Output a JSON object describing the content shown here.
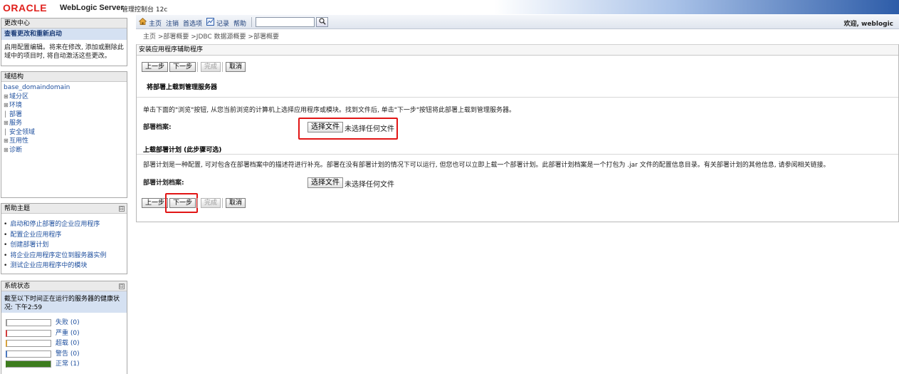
{
  "banner": {
    "logo": "ORACLE",
    "product": "WebLogic Server",
    "subtitle": "管理控制台 12c"
  },
  "change_center": {
    "title": "更改中心",
    "link": "查看更改和重新启动",
    "description": "启用配置编辑。将来在修改, 添加或删除此域中的项目时, 将自动激活这些更改。"
  },
  "domain_structure": {
    "title": "域结构",
    "root": "base_domaindomain",
    "items": [
      {
        "prefix": "⊞",
        "label": "域分区"
      },
      {
        "prefix": "⊞",
        "label": "环境"
      },
      {
        "prefix": "│",
        "label": "部署"
      },
      {
        "prefix": "⊞",
        "label": "服务"
      },
      {
        "prefix": "│",
        "label": "安全领域"
      },
      {
        "prefix": "⊞",
        "label": "互用性"
      },
      {
        "prefix": "⊞",
        "label": "诊断"
      }
    ]
  },
  "help": {
    "title": "帮助主题",
    "toggle": "⊟",
    "items": [
      "启动和停止部署的企业应用程序",
      "配置企业应用程序",
      "创建部署计划",
      "将企业应用程序定位到服务器实例",
      "测试企业应用程序中的模块"
    ]
  },
  "system_status": {
    "title": "系统状态",
    "toggle": "⊟",
    "intro": "截至以下时间正在运行的服务器的健康状况: 下午2:59",
    "rows": [
      {
        "label": "失败 (0)",
        "color": "#9a9a9a",
        "fill": 0
      },
      {
        "label": "严重 (0)",
        "color": "#d43a3a",
        "fill": 0
      },
      {
        "label": "超载 (0)",
        "color": "#d8a23a",
        "fill": 0
      },
      {
        "label": "警告 (0)",
        "color": "#4a78c0",
        "fill": 0
      },
      {
        "label": "正常 (1)",
        "color": "#3d7d1e",
        "fill": 1
      }
    ]
  },
  "toolbar": {
    "home": "主页",
    "logout": "注销",
    "preferences": "首选项",
    "record": "记录",
    "help": "帮助",
    "search_value": "",
    "welcome": "欢迎, weblogic"
  },
  "breadcrumb": "主页 >部署概要 >JDBC 数据源概要 >部署概要",
  "assistant": {
    "title": "安装应用程序辅助程序",
    "back": "上一步",
    "next": "下一步",
    "finish": "完成",
    "cancel": "取消",
    "upload_title": "将部署上载到管理服务器",
    "upload_desc": "单击下面的\"浏览\"按钮, 从您当前浏览的计算机上选择应用程序或模块。找到文件后, 单击\"下一步\"按钮将此部署上载到管理服务器。",
    "archive_label": "部署档案:",
    "choose_file": "选择文件",
    "no_file": "未选择任何文件",
    "plan_title": "上载部署计划 (此步骤可选)",
    "plan_desc": "部署计划是一种配置, 可对包含在部署档案中的描述符进行补充。部署在没有部署计划的情况下可以运行, 但您也可以立即上载一个部署计划。此部署计划档案是一个打包为 .jar 文件的配置信息目录。有关部署计划的其他信息, 请参阅相关链接。",
    "plan_label": "部署计划档案:"
  }
}
